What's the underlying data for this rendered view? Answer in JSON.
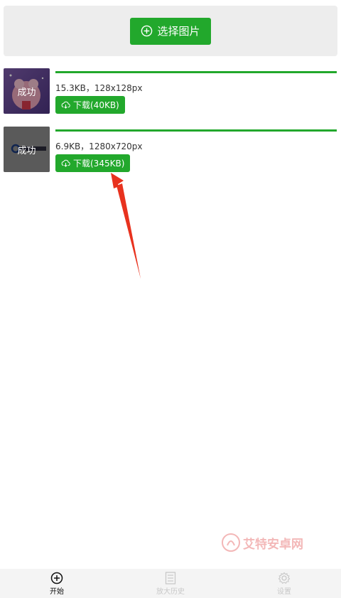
{
  "header": {
    "select_label": "选择图片"
  },
  "items": [
    {
      "status": "成功",
      "progress": 1.0,
      "meta": "15.3KB，128x128px",
      "download_label": "下载(40KB)"
    },
    {
      "status": "成功",
      "progress": 1.0,
      "meta": "6.9KB，1280x720px",
      "download_label": "下载(345KB)"
    }
  ],
  "watermark": "艾特安卓网",
  "tabs": [
    {
      "label": "开始",
      "icon": "plus-circle-icon",
      "active": true
    },
    {
      "label": "放大历史",
      "icon": "document-icon",
      "active": false
    },
    {
      "label": "设置",
      "icon": "gear-icon",
      "active": false
    }
  ],
  "colors": {
    "accent": "#22a82c",
    "arrow": "#e8321e"
  }
}
